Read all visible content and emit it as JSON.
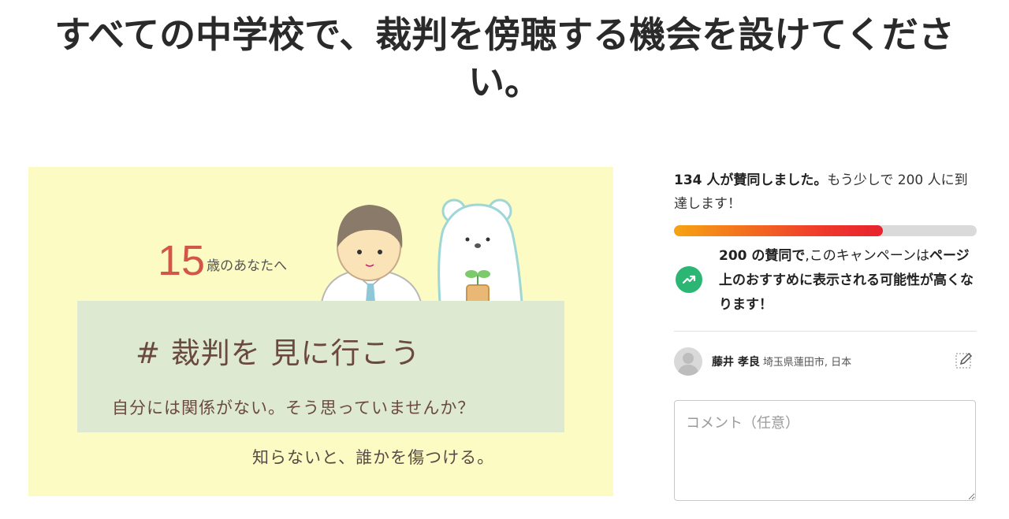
{
  "page": {
    "title": "すべての中学校で、裁判を傍聴する機会を設けてください。"
  },
  "hero": {
    "age_number": "15",
    "age_suffix": "歳のあなたへ",
    "hashtag": "# 裁判を 見に行こう",
    "line1": "自分には関係がない。そう思っていませんか？",
    "line2": "知らないと、誰かを傷つける。"
  },
  "signatures": {
    "count_label": "134 人が賛同しました。",
    "goal_label": "もう少しで 200 人に到達します！",
    "count": 134,
    "goal": 200,
    "progress_fraction": 0.69
  },
  "promo": {
    "bold_lead": "200 の賛同で",
    "text_mid": ",このキャンペーンは",
    "bold_tail": "ページ上のおすすめに表示される可能性が高くなります！",
    "icon": "trending-up-icon"
  },
  "signer": {
    "name": "藤井 孝良",
    "location": "埼玉県蓮田市, 日本"
  },
  "comment": {
    "placeholder": "コメント（任意）"
  },
  "colors": {
    "hero_bg": "#fdfbc4",
    "band_bg": "#dde9d0",
    "progress_start": "#f6a313",
    "progress_end": "#e7222e",
    "promo_icon_bg": "#2bb673",
    "age_accent": "#d0574a"
  }
}
